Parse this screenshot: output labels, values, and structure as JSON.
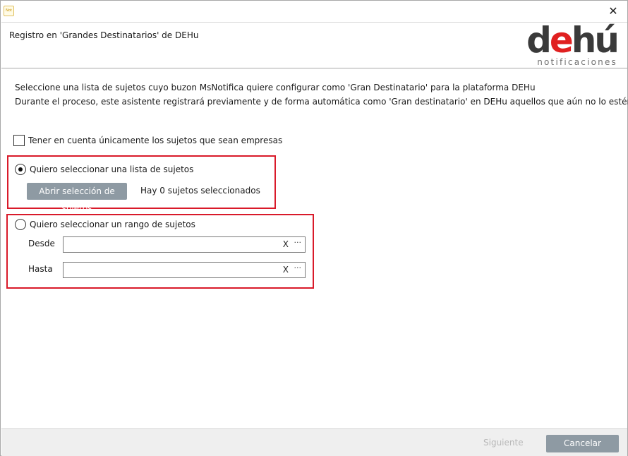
{
  "window": {
    "app_icon_text": "Not",
    "close_glyph": "✕"
  },
  "header": {
    "title": "Registro en 'Grandes Destinatarios' de DEHu",
    "logo": {
      "d": "d",
      "e": "e",
      "hu": "hú",
      "subtitle": "notificaciones"
    }
  },
  "description": {
    "line1": "Seleccione una lista de sujetos cuyo buzon MsNotifica quiere configurar como 'Gran Destinatario' para la plataforma DEHu",
    "line2": "Durante el proceso, este asistente registrará previamente y de forma automática como 'Gran destinatario' en DEHu aquellos que aún no lo estén."
  },
  "only_companies": {
    "label": "Tener en cuenta únicamente los sujetos que sean empresas",
    "checked": false
  },
  "option_list": {
    "label": "Quiero seleccionar una lista de sujetos",
    "selected": true,
    "open_button": "Abrir selección de sujetos",
    "count_text": "Hay 0 sujetos seleccionados"
  },
  "option_range": {
    "label": "Quiero seleccionar un rango de sujetos",
    "selected": false,
    "from": {
      "label": "Desde",
      "value": "",
      "clear": "X",
      "more": "···"
    },
    "to": {
      "label": "Hasta",
      "value": "",
      "clear": "X",
      "more": "···"
    }
  },
  "footer": {
    "next": "Siguiente",
    "cancel": "Cancelar"
  },
  "colors": {
    "accent_red": "#d91a2a",
    "button_gray": "#8e9aa3"
  }
}
